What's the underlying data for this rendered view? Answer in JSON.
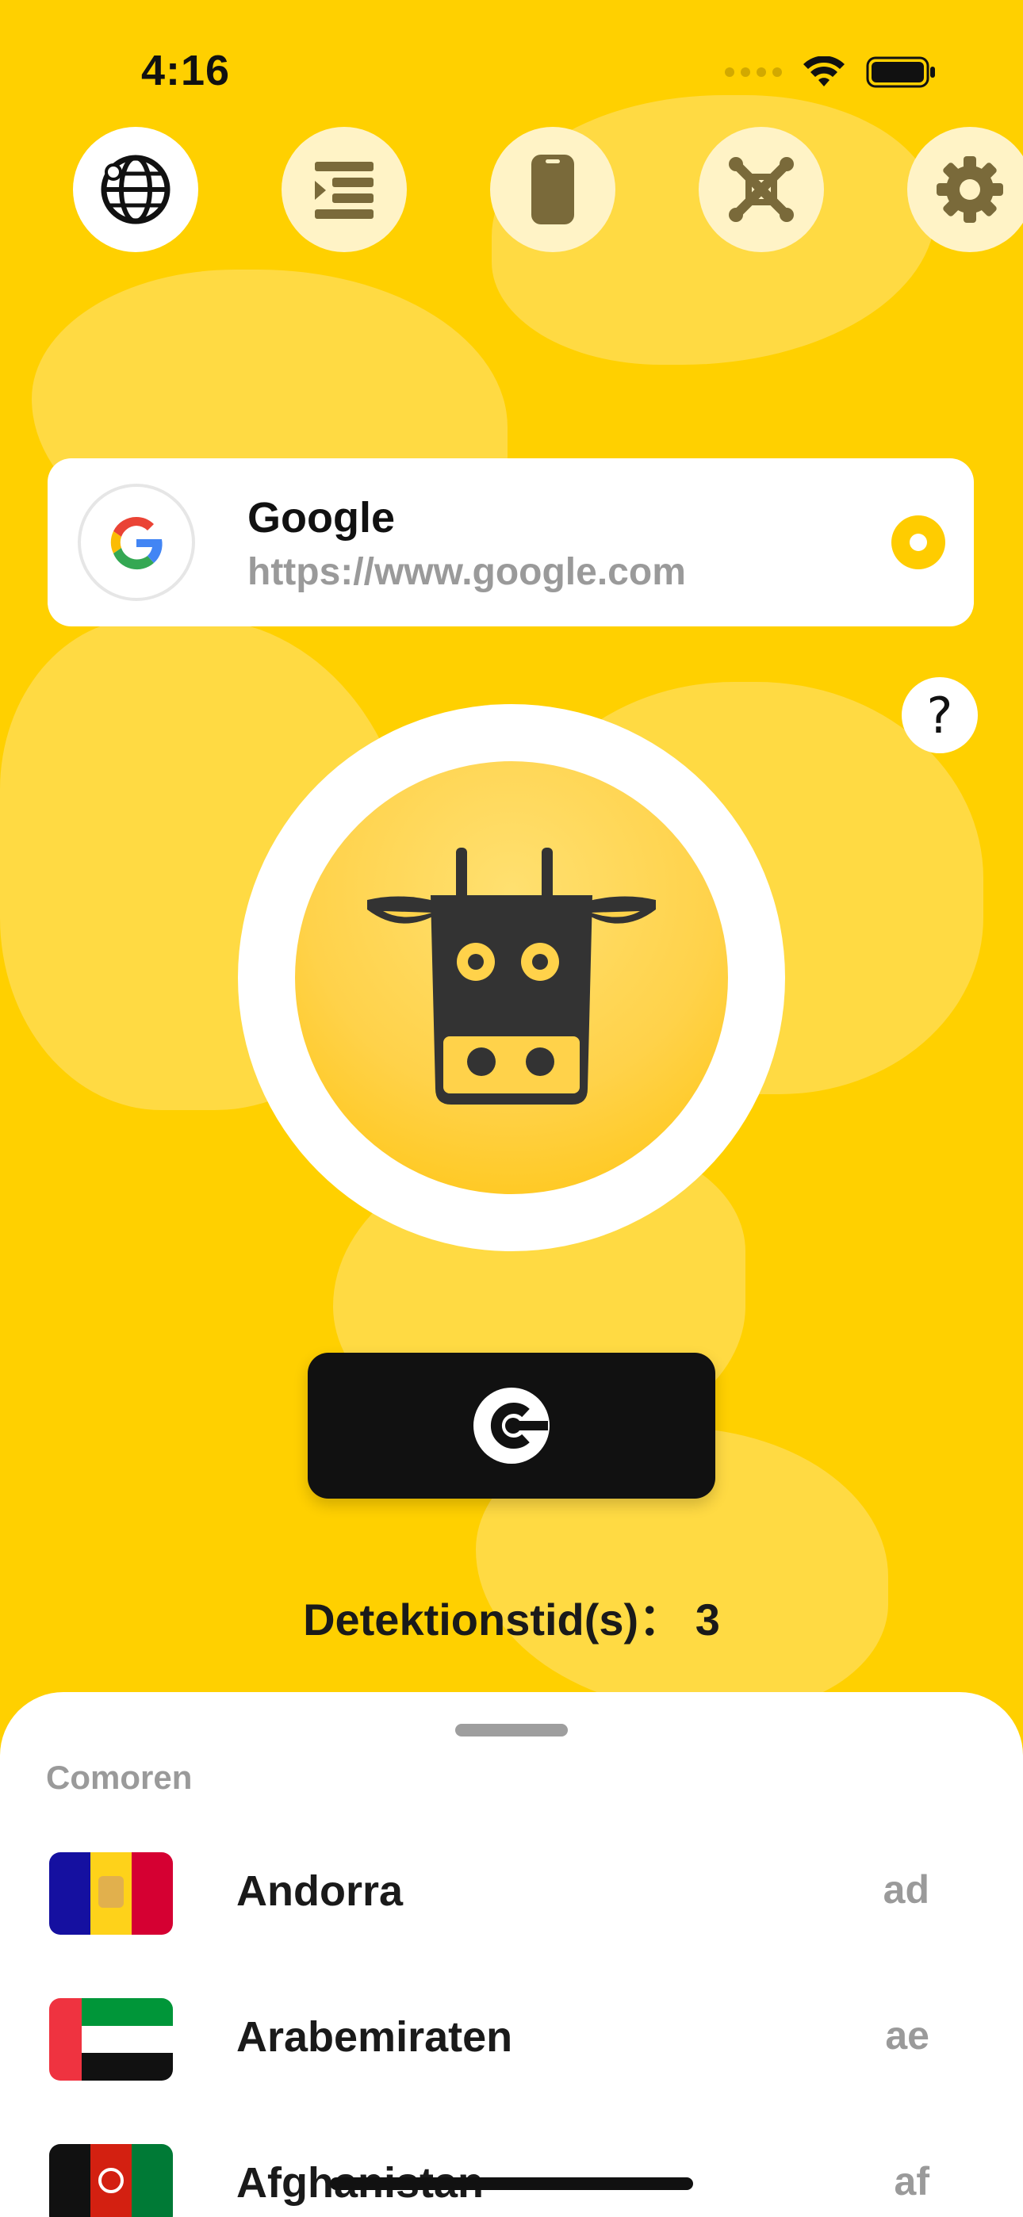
{
  "status_bar": {
    "time": "4:16"
  },
  "top_nav": [
    {
      "name": "globe",
      "active": true
    },
    {
      "name": "list"
    },
    {
      "name": "phone"
    },
    {
      "name": "network"
    },
    {
      "name": "settings"
    }
  ],
  "target": {
    "name": "Google",
    "url": "https://www.google.com"
  },
  "help_label": "?",
  "detection": {
    "text": "Detektionstid(s)： 3"
  },
  "sheet": {
    "section_header": "Comoren",
    "countries": [
      {
        "name": "Andorra",
        "code": "ad"
      },
      {
        "name": "Arabemiraten",
        "code": "ae"
      },
      {
        "name": "Afghanistan",
        "code": "af"
      }
    ]
  },
  "colors": {
    "background": "#FFD000",
    "accent": "#FFCC00",
    "dark": "#111111"
  }
}
